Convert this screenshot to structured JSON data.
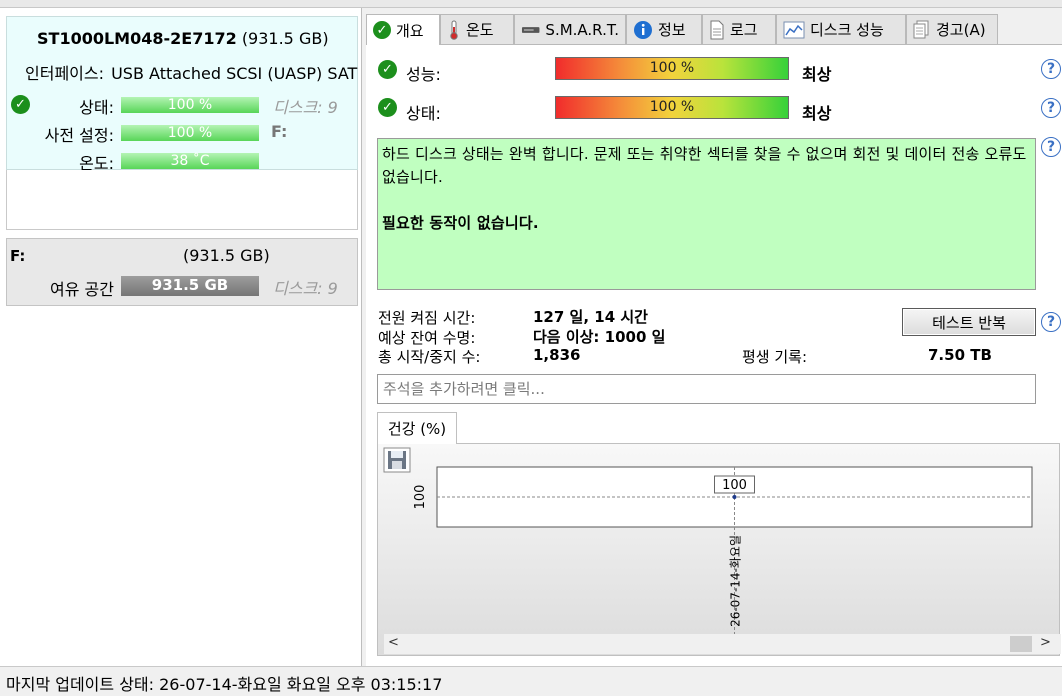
{
  "disk": {
    "model": "ST1000LM048-2E7172",
    "size": "(931.5 GB)",
    "interface_label": "인터페이스:",
    "interface_value": "USB Attached SCSI (UASP) SAT",
    "status_label": "상태:",
    "status_value": "100 %",
    "disk_index": "디스크: 9",
    "preset_label": "사전 설정:",
    "preset_value": "100 %",
    "drive_letter": "F:",
    "temp_label": "온도:",
    "temp_value": "38 ˚C"
  },
  "volume": {
    "letter": "F:",
    "size": "(931.5 GB)",
    "free_label": "여유 공간",
    "free_value": "931.5 GB",
    "disk_index": "디스크: 9"
  },
  "tabs": [
    {
      "label": "개요",
      "icon": "check-icon"
    },
    {
      "label": "온도",
      "icon": "thermometer-icon"
    },
    {
      "label": "S.M.A.R.T.",
      "icon": "drive-icon"
    },
    {
      "label": "정보",
      "icon": "info-icon"
    },
    {
      "label": "로그",
      "icon": "document-icon"
    },
    {
      "label": "디스크 성능",
      "icon": "chart-icon"
    },
    {
      "label": "경고(A)",
      "icon": "clipboard-icon"
    }
  ],
  "overview": {
    "performance_label": "성능:",
    "performance_value": "100 %",
    "performance_rating": "최상",
    "health_label": "상태:",
    "health_value": "100 %",
    "health_rating": "최상",
    "status_text": "하드 디스크 상태는 완벽 합니다. 문제 또는 취약한 섹터를 찾을 수 없으며 회전 및 데이터 전송 오류도 없습니다.",
    "action_text": "필요한 동작이 없습니다.",
    "power_on_label": "전원 켜짐 시간:",
    "power_on_value": "127 일, 14 시간",
    "remaining_label": "예상 잔여 수명:",
    "remaining_value": "다음 이상: 1000 일",
    "start_stop_label": "총 시작/중지 수:",
    "start_stop_value": "1,836",
    "lifetime_label": "평생 기록:",
    "lifetime_value": "7.50 TB",
    "repeat_test_label": "테스트 반복",
    "comment_placeholder": "주석을 추가하려면 클릭...",
    "help_glyph": "?",
    "check_glyph": "✓"
  },
  "health_chart": {
    "tab_label": "건강 (%)",
    "scroll_left": "<",
    "scroll_right": ">"
  },
  "chart_data": {
    "type": "line",
    "x": [
      "26-07-14-화요일"
    ],
    "values": [
      100
    ],
    "ytick_labels": [
      "100"
    ],
    "data_labels": [
      "100"
    ],
    "ylim": [
      99,
      101
    ],
    "grid": true,
    "legend": "none"
  },
  "status_bar": {
    "text": "마지막 업데이트 상태: 26-07-14-화요일 화요일 오후 03:15:17"
  },
  "colors": {
    "disk_card_bg": "#eafdfd",
    "status_box_bg": "#c0ffc0",
    "ok_green": "#1c8f1c",
    "help_blue": "#3a70c4"
  }
}
